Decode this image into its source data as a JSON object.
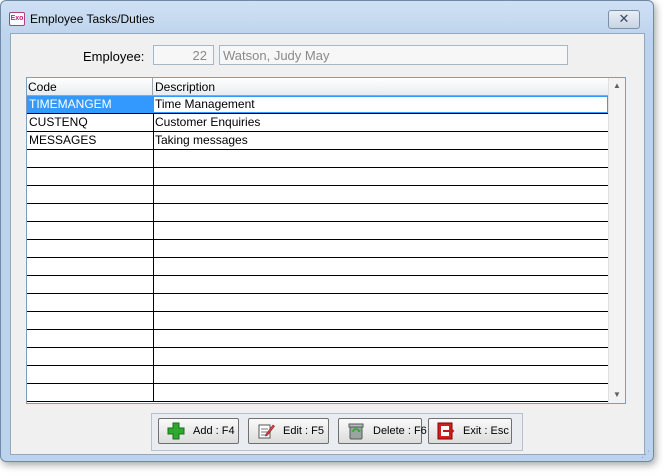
{
  "window": {
    "title": "Employee Tasks/Duties",
    "app_icon_text": "Exo",
    "close_glyph": "✕"
  },
  "employee": {
    "label": "Employee:",
    "id": "22",
    "name": "Watson, Judy May"
  },
  "grid": {
    "columns": [
      "Code",
      "Description"
    ],
    "rows": [
      {
        "code": "TIMEMANGEM",
        "description": "Time Management",
        "selected": true
      },
      {
        "code": "CUSTENQ",
        "description": "Customer Enquiries",
        "selected": false
      },
      {
        "code": "MESSAGES",
        "description": "Taking messages",
        "selected": false
      }
    ],
    "empty_rows": 14,
    "selection_color": "#3399ff"
  },
  "buttons": {
    "add": {
      "label": "Add : F4",
      "icon": "plus-icon"
    },
    "edit": {
      "label": "Edit : F5",
      "icon": "edit-note-icon"
    },
    "delete": {
      "label": "Delete : F6",
      "icon": "recycle-bin-icon"
    },
    "exit": {
      "label": "Exit : Esc",
      "icon": "exit-door-icon"
    }
  }
}
